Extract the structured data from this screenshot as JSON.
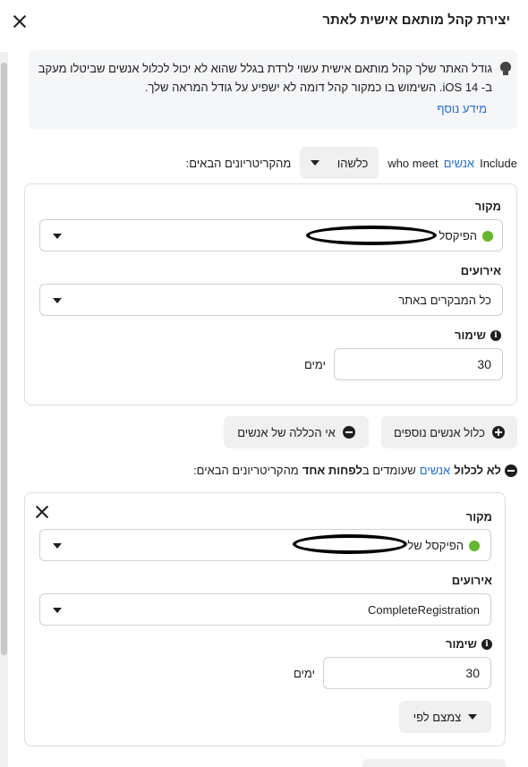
{
  "header": {
    "title": "יצירת קהל מותאם אישית לאתר"
  },
  "info": {
    "text": "גודל האתר שלך קהל מותאם אישית עשוי לרדת בגלל שהוא לא יכול לכלול אנשים שביטלו מעקב ב- iOS 14. השימוש בו כמקור קהל דומה לא ישפיע על גודל המראה שלך.",
    "more_link": "מידע נוסף"
  },
  "include_row": {
    "prefix": "Include",
    "people_link": "אנשים",
    "who_meet": "who meet",
    "dropdown": "כלשהו",
    "suffix": "מהקריטריונים הבאים:"
  },
  "include_card": {
    "source_label": "מקור",
    "source_value": "הפיקסל",
    "events_label": "אירועים",
    "events_value": "כל המבקרים באתר",
    "retention_label": "שימור",
    "retention_value": "30",
    "retention_unit": "ימים"
  },
  "actions": {
    "include_more": "כלול אנשים נוספים",
    "exclude": "אי הכללה של אנשים"
  },
  "exclude_row": {
    "bold": "לא לכלול",
    "people_link": "אנשים",
    "middle": "שעומדים ב",
    "at_least_one": "לפחות אחד",
    "suffix": "מהקריטריונים הבאים:"
  },
  "exclude_card": {
    "source_label": "מקור",
    "source_value": "הפיקסל של",
    "events_label": "אירועים",
    "events_value": "CompleteRegistration",
    "retention_label": "שימור",
    "retention_value": "30",
    "retention_unit": "ימים",
    "narrow_button": "צמצם לפי"
  }
}
